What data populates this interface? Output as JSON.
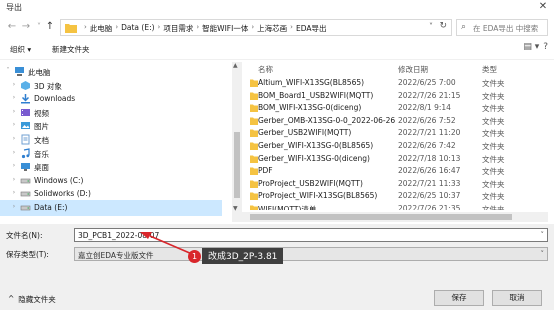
{
  "window": {
    "title": "导出",
    "close_glyph": "✕"
  },
  "nav_buttons": {
    "back": "←",
    "forward": "→",
    "up_dropdown": "˅",
    "up": "↑"
  },
  "address": {
    "crumbs": [
      "此电脑",
      "Data (E:)",
      "项目需求",
      "智能WIFI一体",
      "上海芯画",
      "EDA导出"
    ],
    "separator": "›",
    "dropdown": "˅",
    "refresh": "↻"
  },
  "search": {
    "placeholder": "在 EDA导出 中搜索",
    "icon": "search-icon"
  },
  "toolbar": {
    "organize": "组织 ▾",
    "new_folder": "新建文件夹",
    "view_glyph": "▤ ▾",
    "help_glyph": "?"
  },
  "nav_tree": [
    {
      "label": "此电脑",
      "icon": "computer-icon",
      "level": 0,
      "expander": "˅"
    },
    {
      "label": "3D 对象",
      "icon": "3d-objects-icon",
      "level": 1,
      "expander": "›"
    },
    {
      "label": "Downloads",
      "icon": "downloads-icon",
      "level": 1,
      "expander": "›"
    },
    {
      "label": "视频",
      "icon": "video-icon",
      "level": 1,
      "expander": "›"
    },
    {
      "label": "图片",
      "icon": "pictures-icon",
      "level": 1,
      "expander": "›"
    },
    {
      "label": "文档",
      "icon": "documents-icon",
      "level": 1,
      "expander": "›"
    },
    {
      "label": "音乐",
      "icon": "music-icon",
      "level": 1,
      "expander": "›"
    },
    {
      "label": "桌面",
      "icon": "desktop-icon",
      "level": 1,
      "expander": "›"
    },
    {
      "label": "Windows (C:)",
      "icon": "drive-icon",
      "level": 1,
      "expander": "›"
    },
    {
      "label": "Solidworks (D:)",
      "icon": "drive-icon",
      "level": 1,
      "expander": "›"
    },
    {
      "label": "Data (E:)",
      "icon": "drive-icon",
      "level": 1,
      "expander": "›",
      "selected": true
    }
  ],
  "file_columns": {
    "name": "名称",
    "date": "修改日期",
    "type": "类型",
    "sort_glyph": "^"
  },
  "files": [
    {
      "name": "Altium_WIFI-X13SG(BL8565)",
      "date": "2022/6/25 7:00",
      "type": "文件夹"
    },
    {
      "name": "BOM_Board1_USB2WIFI(MQTT)",
      "date": "2022/7/26 21:15",
      "type": "文件夹"
    },
    {
      "name": "BOM_WIFI-X13SG-0(diceng)",
      "date": "2022/8/1 9:14",
      "type": "文件夹"
    },
    {
      "name": "Gerber_OMB-X13SG-0-0_2022-06-26",
      "date": "2022/6/26 7:52",
      "type": "文件夹"
    },
    {
      "name": "Gerber_USB2WIFI(MQTT)",
      "date": "2022/7/21 11:20",
      "type": "文件夹"
    },
    {
      "name": "Gerber_WIFI-X13SG-0(BL8565)",
      "date": "2022/6/26 7:42",
      "type": "文件夹"
    },
    {
      "name": "Gerber_WIFI-X13SG-0(diceng)",
      "date": "2022/7/18 10:13",
      "type": "文件夹"
    },
    {
      "name": "PDF",
      "date": "2022/6/26 16:47",
      "type": "文件夹"
    },
    {
      "name": "ProProject_USB2WIFI(MQTT)",
      "date": "2022/7/21 11:33",
      "type": "文件夹"
    },
    {
      "name": "ProProject_WIFI-X13SG(BL8565)",
      "date": "2022/6/25 10:37",
      "type": "文件夹"
    },
    {
      "name": "WIFI(MQTT)清单",
      "date": "2022/7/26 21:35",
      "type": "文件夹"
    }
  ],
  "filename": {
    "label": "文件名(N):",
    "value": "3D_PCB1_2022-08-07",
    "dropdown": "˅"
  },
  "filetype": {
    "label": "保存类型(T):",
    "value": "嘉立创EDA专业版文件",
    "dropdown": "˅"
  },
  "annotation": {
    "badge": "1",
    "text": "改成3D_2P-3.81",
    "color": "#d9262b"
  },
  "hide_folders": {
    "glyph": "^",
    "label": "隐藏文件夹"
  },
  "buttons": {
    "save": "保存",
    "cancel": "取消"
  },
  "scroll": {
    "up": "▲",
    "down": "▼"
  },
  "colors": {
    "folder": "#f5c342",
    "selection": "#cce8ff",
    "accent": "#0078d7"
  }
}
